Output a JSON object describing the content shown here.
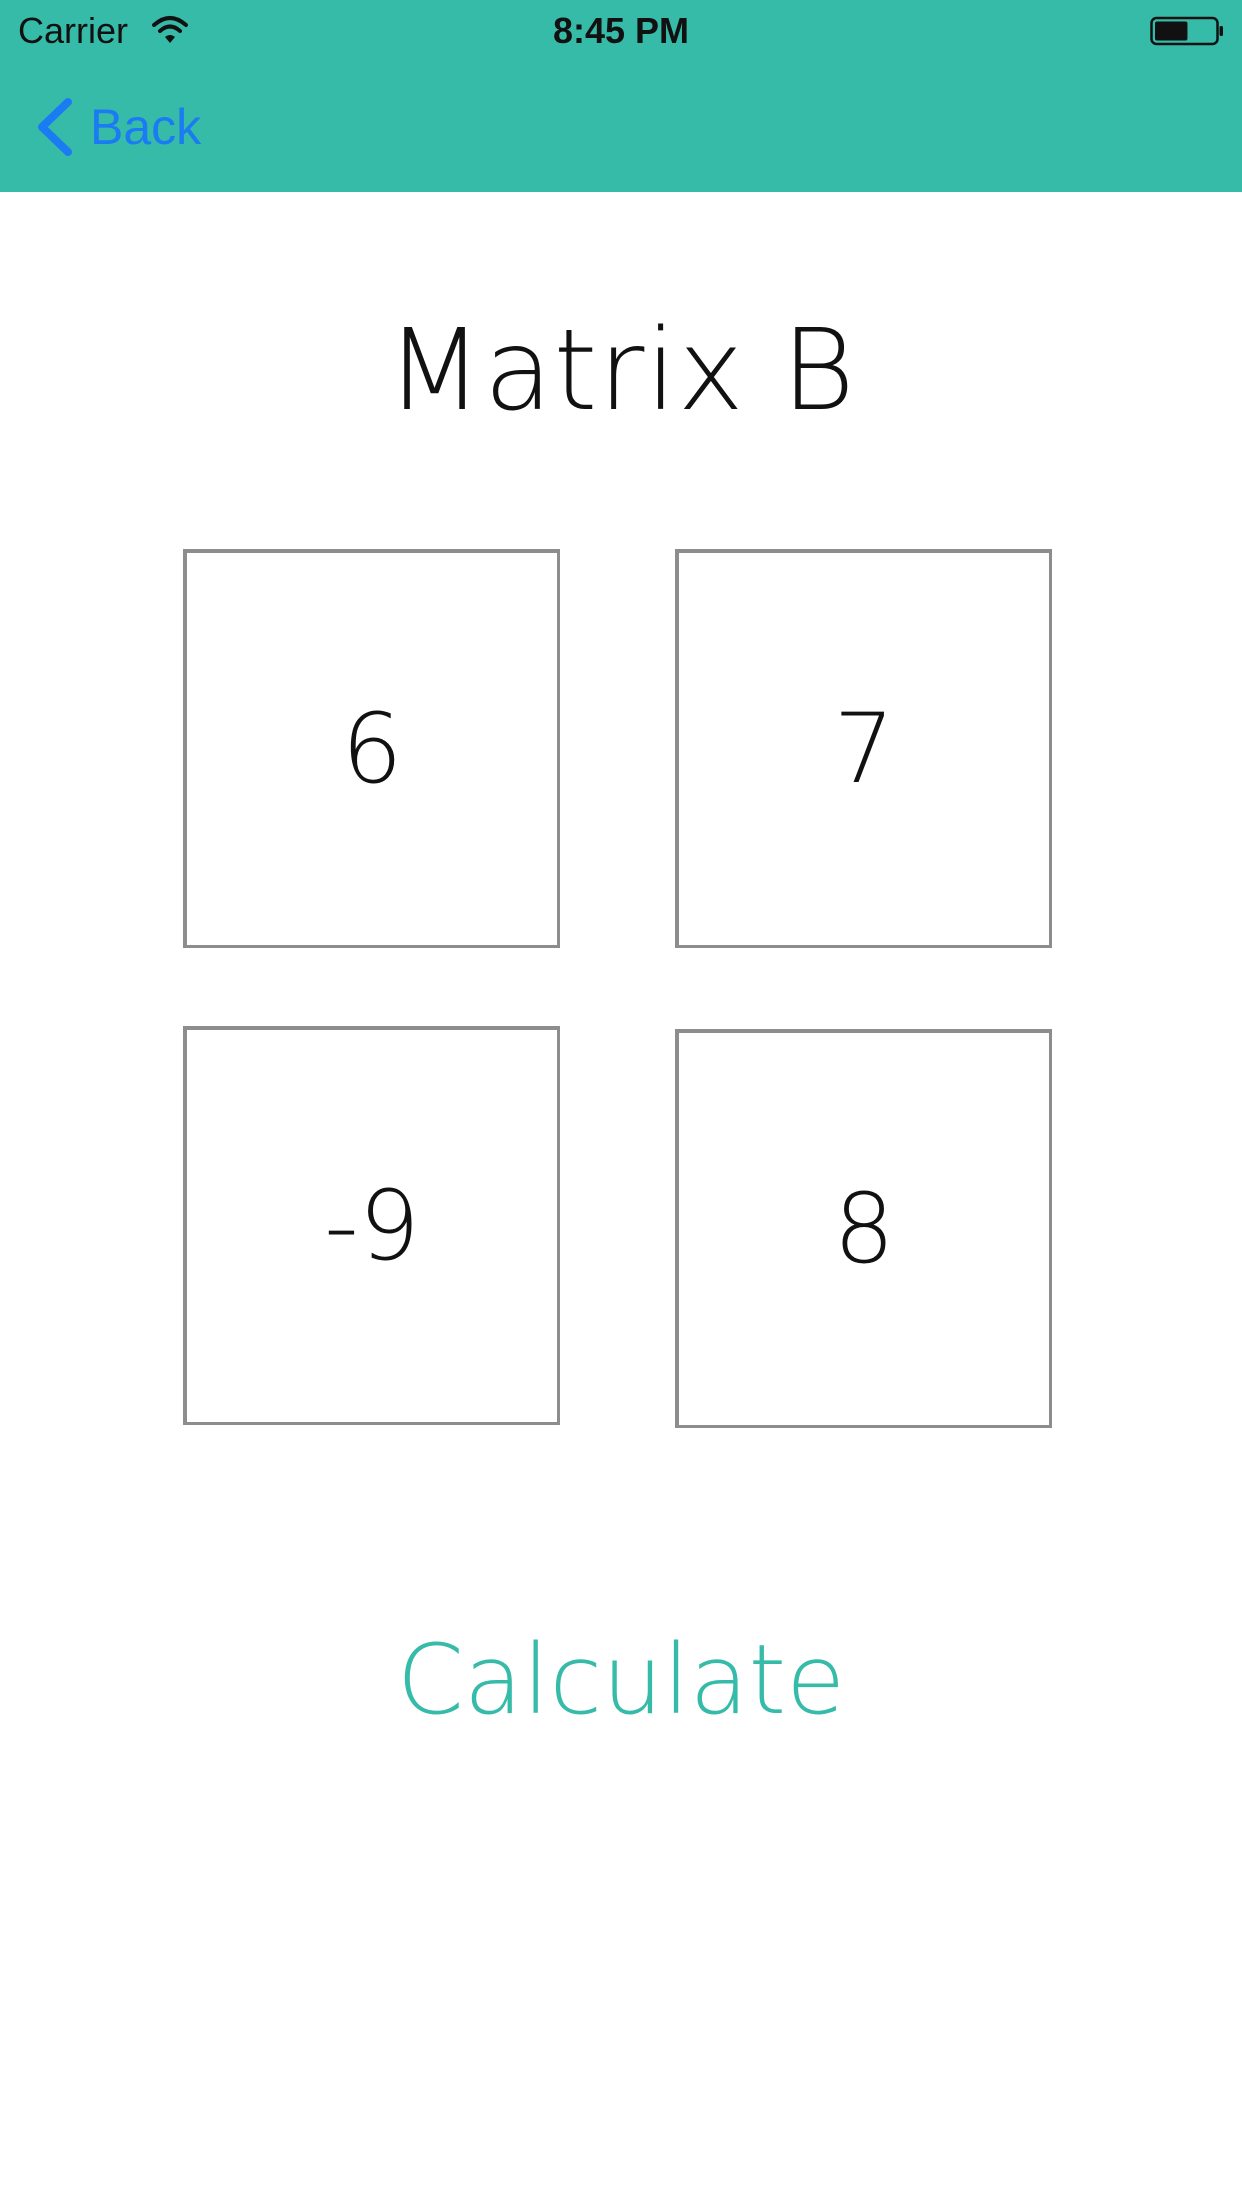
{
  "status_bar": {
    "carrier": "Carrier",
    "time": "8:45 PM",
    "wifi_icon": "wifi-icon",
    "battery_icon": "battery-icon",
    "battery_level": 0.55
  },
  "nav": {
    "back_label": "Back",
    "back_icon": "chevron-left-icon",
    "accent_color": "#1b7bf2",
    "bar_color": "#37bba9"
  },
  "matrix": {
    "title": "Matrix B",
    "cells": [
      "6",
      "7",
      "-9",
      "8"
    ]
  },
  "actions": {
    "calculate_label": "Calculate",
    "calculate_color": "#37bba9"
  }
}
